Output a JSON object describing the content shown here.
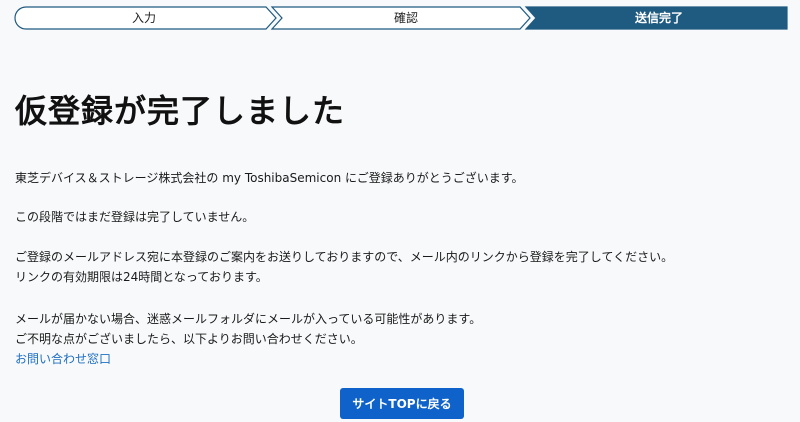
{
  "stepper": {
    "steps": [
      {
        "label": "入力",
        "active": false
      },
      {
        "label": "確認",
        "active": false
      },
      {
        "label": "送信完了",
        "active": true
      }
    ],
    "active_color": "#1f5a80",
    "inactive_color": "#ffffff"
  },
  "title": "仮登録が完了しました",
  "paragraphs": [
    "東芝デバイス＆ストレージ株式会社の my ToshibaSemicon にご登録ありがとうございます。",
    "この段階ではまだ登録は完了していません。",
    "ご登録のメールアドレス宛に本登録のご案内をお送りしておりますので、メール内のリンクから登録を完了してください。",
    "リンクの有効期限は24時間となっております。",
    "メールが届かない場合、迷惑メールフォルダにメールが入っている可能性があります。",
    "ご不明な点がございましたら、以下よりお問い合わせください。"
  ],
  "contact_link": "お問い合わせ窓口",
  "top_button": "サイトTOPに戻る",
  "colors": {
    "link": "#1f6fc2",
    "button": "#0e62c9"
  }
}
